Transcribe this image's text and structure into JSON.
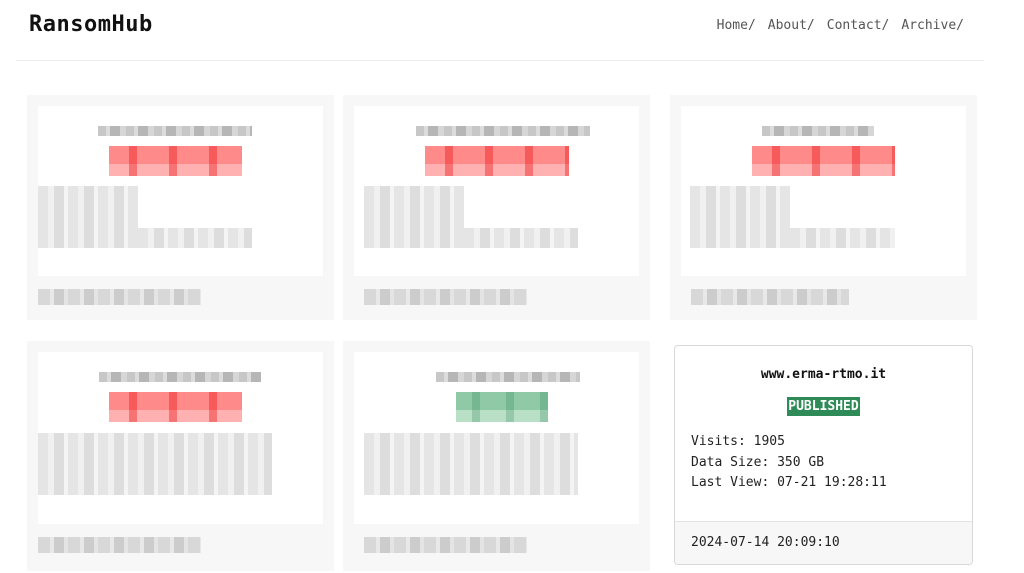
{
  "header": {
    "brand": "RansomHub",
    "nav": [
      {
        "label": "Home/"
      },
      {
        "label": "About/"
      },
      {
        "label": "Contact/"
      },
      {
        "label": "Archive/"
      }
    ]
  },
  "featured_card": {
    "domain": "www.erma-rtmo.it",
    "status": "PUBLISHED",
    "status_color": "#2e8b57",
    "visits": "Visits: 1905",
    "data_size": "Data Size: 350 GB",
    "last_view": "Last View: 07-21 19:28:11",
    "date": "2024-07-14 20:09:10"
  },
  "blurred_cards": [
    {
      "status_color": "#ff8a8a"
    },
    {
      "status_color": "#ff8a8a"
    },
    {
      "status_color": "#ff8a8a"
    },
    {
      "status_color": "#ff8a8a"
    },
    {
      "status_color": "#8fc9a5"
    }
  ]
}
